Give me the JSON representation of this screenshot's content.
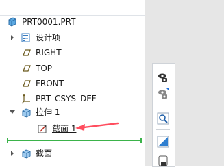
{
  "model_tree": {
    "root": {
      "label": "PRT0001.PRT",
      "icon": "part-icon"
    },
    "items": [
      {
        "label": "设计项",
        "icon": "design-items-icon",
        "expandable": true
      },
      {
        "label": "RIGHT",
        "icon": "datum-plane-icon"
      },
      {
        "label": "TOP",
        "icon": "datum-plane-icon"
      },
      {
        "label": "FRONT",
        "icon": "datum-plane-icon"
      },
      {
        "label": "PRT_CSYS_DEF",
        "icon": "coordinate-system-icon"
      },
      {
        "label": "拉伸 1",
        "icon": "extrude-icon",
        "expanded": true
      },
      {
        "label": "截面 1",
        "icon": "sketch-icon",
        "child_of": "拉伸 1"
      },
      {
        "label": "截面",
        "icon": "section-icon",
        "expandable": true
      }
    ],
    "insert_here_indicator": "insert-line"
  },
  "annotation": {
    "arrow_color": "#ff4d5e"
  },
  "toolbar": {
    "buttons": [
      {
        "icon": "appearance-camera-icon"
      },
      {
        "icon": "hide-camera-icon"
      },
      {
        "icon": "zoom-icon"
      },
      {
        "icon": "display-style-icon"
      },
      {
        "icon": "saved-view-icon"
      }
    ]
  },
  "colors": {
    "insert_line": "#3bb34a",
    "datum": "#6b5a1e",
    "feature_blue": "#3a8fd1"
  }
}
